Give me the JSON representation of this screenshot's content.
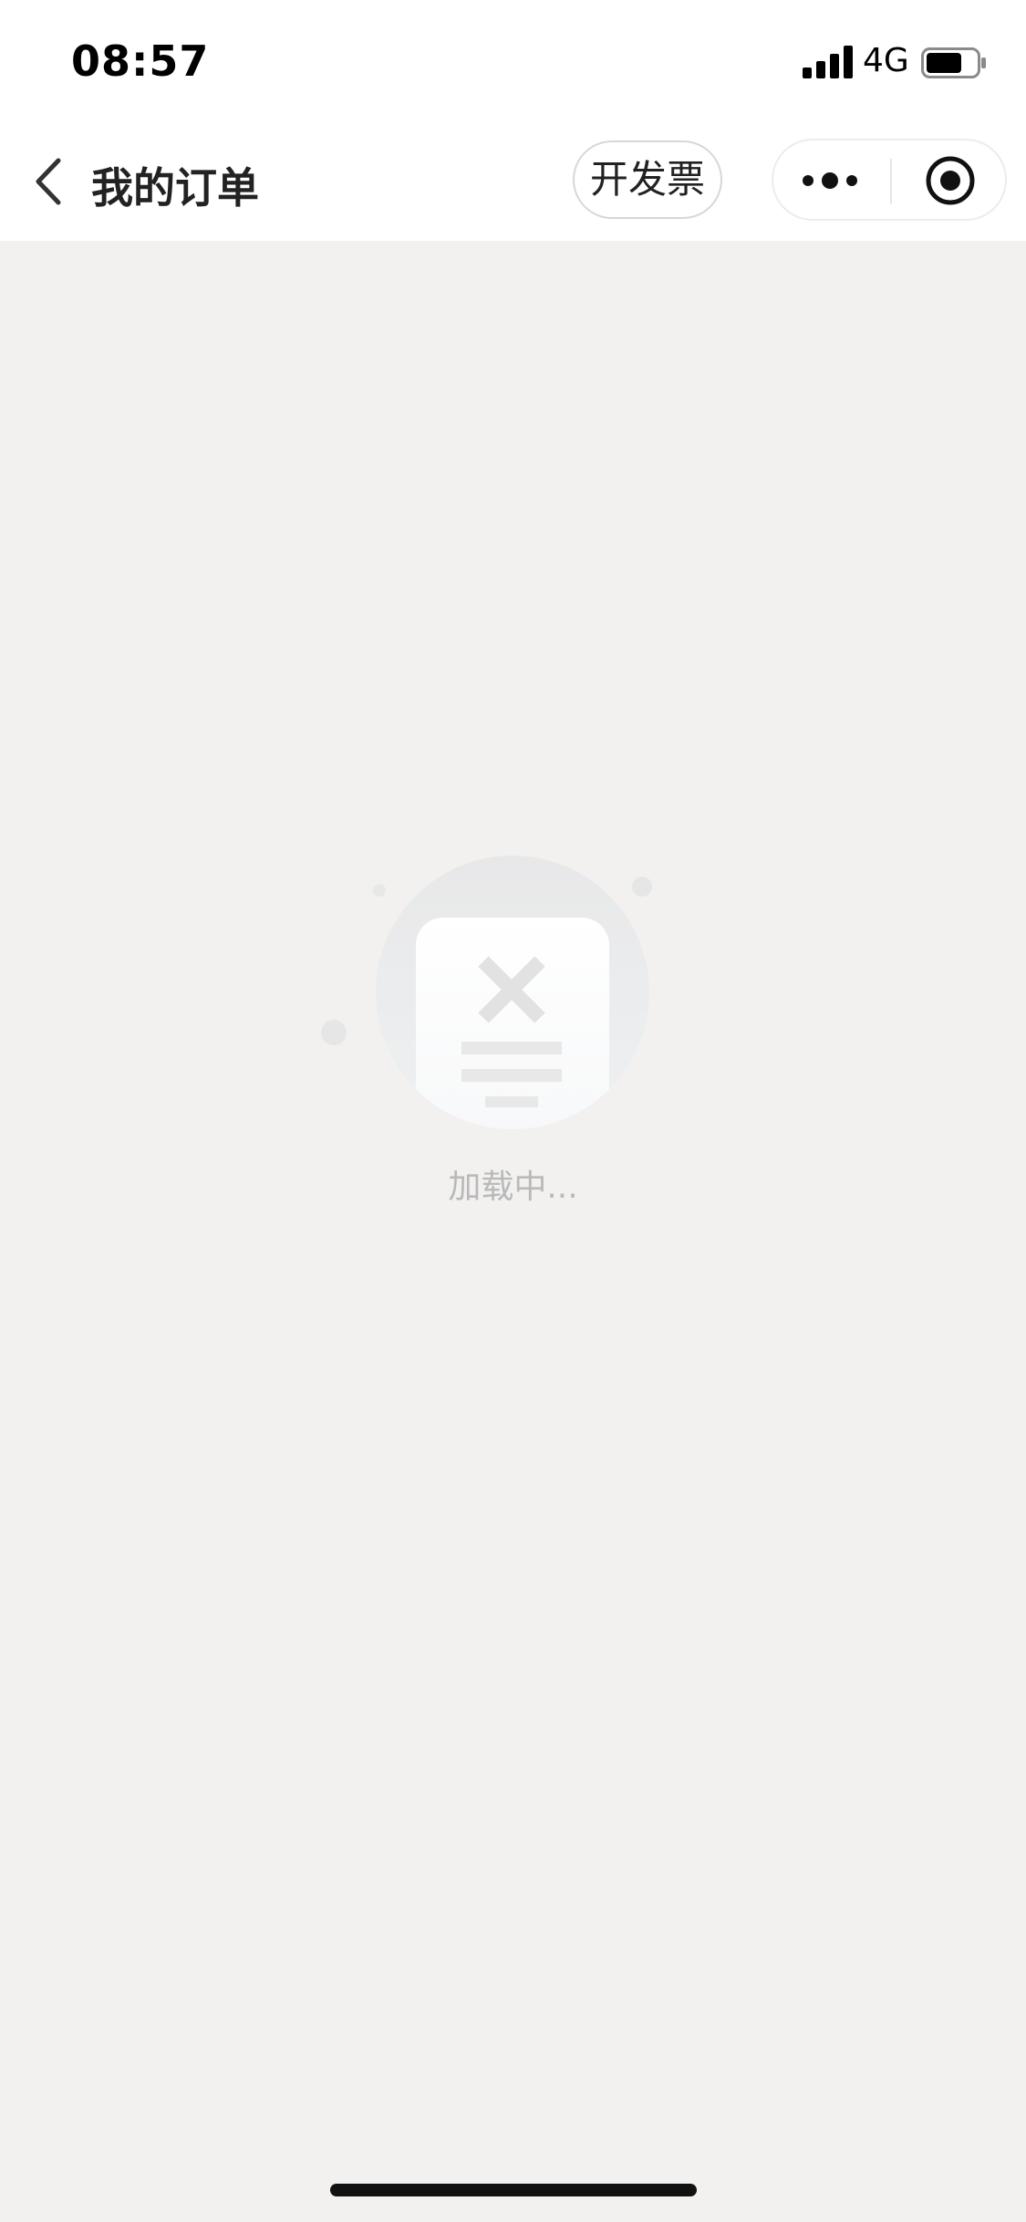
{
  "status_bar": {
    "time": "08:57",
    "network": "4G",
    "icons": [
      "signal-icon",
      "battery-icon"
    ]
  },
  "nav": {
    "back_icon": "chevron-left-icon",
    "title": "我的订单",
    "invoice_button_label": "开发票",
    "capsule_icons": [
      "more-dots-icon",
      "close-target-icon"
    ]
  },
  "content": {
    "illustration": "empty-document-icon",
    "loading_text": "加载中..."
  },
  "colors": {
    "page_background": "#f2f1f0",
    "bar_background": "#ffffff",
    "loading_text": "#b9b9b9",
    "title_text": "#222222"
  }
}
